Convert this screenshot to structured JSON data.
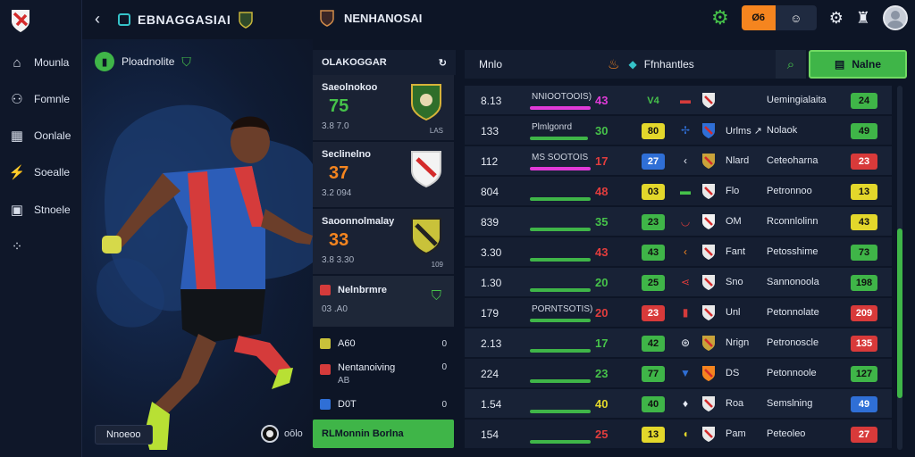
{
  "colors": {
    "green": "#3fb548",
    "orange": "#f5851f",
    "red": "#d83a3a",
    "yellow": "#e3d72b",
    "blue": "#2f6fd6",
    "magenta": "#e03ad8",
    "bg": "#0d1526"
  },
  "sidebar": {
    "items": [
      {
        "label": "Mounla",
        "icon": "home-icon"
      },
      {
        "label": "Fomnle",
        "icon": "people-icon"
      },
      {
        "label": "Oonlale",
        "icon": "calendar-icon"
      },
      {
        "label": "Soealle",
        "icon": "stats-icon"
      },
      {
        "label": "Stnoele",
        "icon": "table-icon"
      },
      {
        "label": "",
        "icon": "grid-icon"
      }
    ]
  },
  "header": {
    "title": "EBNAGGASIAI",
    "match_title": "NENHANOSAI",
    "toggle_left": "Ø6"
  },
  "hero": {
    "tag": "Ploadnolite",
    "button": "Nnoeoo",
    "radio_label": "oōlo"
  },
  "list": {
    "header": "OLAKOGGAR",
    "cards": [
      {
        "name": "Saeolnokoo",
        "value": "75",
        "sub": "3.8 7.0",
        "tiny": "LAS"
      },
      {
        "name": "Seclinelno",
        "value": "37",
        "sub": "3.2 094",
        "tiny": ""
      },
      {
        "name": "Saoonnolmalay",
        "value": "33",
        "sub": "3.8 3.30",
        "tiny": "109"
      }
    ],
    "minis": [
      {
        "name": "Nelnbrmre",
        "sub": "03 .A0",
        "end": ""
      },
      {
        "name": "A60",
        "sub": "",
        "end": "0"
      },
      {
        "name": "Nentanoiving",
        "sub": "AB",
        "end": "0"
      },
      {
        "name": "D0T",
        "sub": "",
        "end": "0"
      }
    ],
    "footer": "RLMonnin Borlna"
  },
  "table": {
    "header_left": "Mnlo",
    "header_right": "Ffnhantles",
    "main_button": "Nalne",
    "rows": [
      {
        "time": "8.13",
        "bar_label": "NNIOOTOOIS)",
        "bar_pct": 1.0,
        "bar_color": "#e03ad8",
        "num": "43",
        "num_color": "#e03ad8",
        "pill": "V4",
        "pill_color": "transparent",
        "pill_text_color": "#46c24a",
        "team": "",
        "name": "Uemingialaita",
        "score": "24",
        "score_color": "#3fb548"
      },
      {
        "time": "133",
        "bar_label": "Plmlgonrd",
        "bar_pct": 0.95,
        "bar_color": "#3fb548",
        "num": "30",
        "num_color": "#46c24a",
        "pill": "80",
        "pill_color": "#e3d72b",
        "pill_text_color": "#111",
        "team": "Urlms ↗",
        "name": "Nolaok",
        "score": "49",
        "score_color": "#3fb548"
      },
      {
        "time": "112",
        "bar_label": "MS SOOTOIS",
        "bar_pct": 1.0,
        "bar_color": "#e03ad8",
        "num": "17",
        "num_color": "#e23d3d",
        "pill": "27",
        "pill_color": "#2f6fd6",
        "pill_text_color": "#fff",
        "team": "Nlard",
        "name": "Ceteoharna",
        "score": "23",
        "score_color": "#d83a3a"
      },
      {
        "time": "804",
        "bar_label": "",
        "bar_pct": 1.0,
        "bar_color": "#3fb548",
        "num": "48",
        "num_color": "#e23d3d",
        "pill": "03",
        "pill_color": "#e3d72b",
        "pill_text_color": "#111",
        "team": "Flo",
        "name": "Petronnoo",
        "score": "13",
        "score_color": "#e3d72b"
      },
      {
        "time": "839",
        "bar_label": "",
        "bar_pct": 1.0,
        "bar_color": "#3fb548",
        "num": "35",
        "num_color": "#46c24a",
        "pill": "23",
        "pill_color": "#3fb548",
        "pill_text_color": "#111",
        "team": "OM",
        "name": "Rconnlolinn",
        "score": "43",
        "score_color": "#e3d72b"
      },
      {
        "time": "3.30",
        "bar_label": "",
        "bar_pct": 1.0,
        "bar_color": "#3fb548",
        "num": "43",
        "num_color": "#e23d3d",
        "pill": "43",
        "pill_color": "#3fb548",
        "pill_text_color": "#111",
        "team": "Fant",
        "name": "Petosshime",
        "score": "73",
        "score_color": "#3fb548"
      },
      {
        "time": "1.30",
        "bar_label": "",
        "bar_pct": 1.0,
        "bar_color": "#3fb548",
        "num": "20",
        "num_color": "#46c24a",
        "pill": "25",
        "pill_color": "#3fb548",
        "pill_text_color": "#111",
        "team": "Sno",
        "name": "Sannonoola",
        "score": "198",
        "score_color": "#3fb548"
      },
      {
        "time": "179",
        "bar_label": "PORNTSOTIS)",
        "bar_pct": 1.0,
        "bar_color": "#3fb548",
        "num": "20",
        "num_color": "#e23d3d",
        "pill": "23",
        "pill_color": "#d83a3a",
        "pill_text_color": "#fff",
        "team": "Unl",
        "name": "Petonnolate",
        "score": "209",
        "score_color": "#d83a3a"
      },
      {
        "time": "2.13",
        "bar_label": "",
        "bar_pct": 1.0,
        "bar_color": "#3fb548",
        "num": "17",
        "num_color": "#46c24a",
        "pill": "42",
        "pill_color": "#3fb548",
        "pill_text_color": "#111",
        "team": "Nrign",
        "name": "Petronoscle",
        "score": "135",
        "score_color": "#d83a3a"
      },
      {
        "time": "224",
        "bar_label": "",
        "bar_pct": 1.0,
        "bar_color": "#3fb548",
        "num": "23",
        "num_color": "#46c24a",
        "pill": "77",
        "pill_color": "#3fb548",
        "pill_text_color": "#111",
        "team": "DS",
        "name": "Petonnoole",
        "score": "127",
        "score_color": "#3fb548"
      },
      {
        "time": "1.54",
        "bar_label": "",
        "bar_pct": 1.0,
        "bar_color": "#3fb548",
        "num": "40",
        "num_color": "#e3d72b",
        "pill": "40",
        "pill_color": "#3fb548",
        "pill_text_color": "#111",
        "team": "Roa",
        "name": "Semslning",
        "score": "49",
        "score_color": "#2f6fd6"
      },
      {
        "time": "154",
        "bar_label": "",
        "bar_pct": 1.0,
        "bar_color": "#3fb548",
        "num": "25",
        "num_color": "#e23d3d",
        "pill": "13",
        "pill_color": "#e3d72b",
        "pill_text_color": "#111",
        "team": "Pam",
        "name": "Peteoleo",
        "score": "27",
        "score_color": "#d83a3a"
      }
    ]
  }
}
